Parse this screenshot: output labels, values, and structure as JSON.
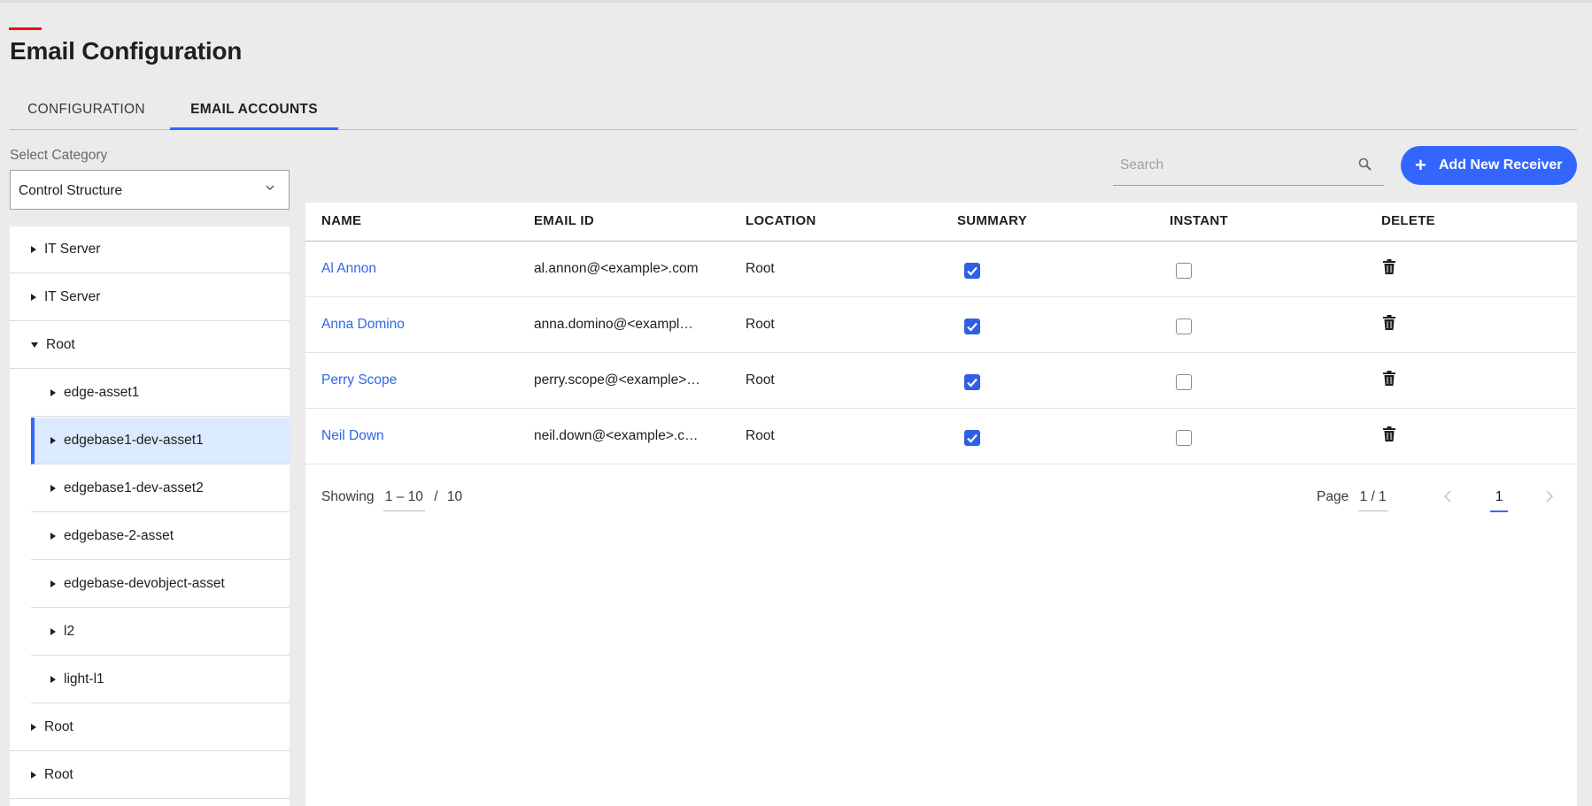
{
  "page": {
    "title": "Email Configuration"
  },
  "tabs": [
    {
      "label": "CONFIGURATION",
      "active": false
    },
    {
      "label": "EMAIL ACCOUNTS",
      "active": true
    }
  ],
  "category": {
    "label": "Select Category",
    "selected": "Control Structure"
  },
  "tree": [
    {
      "label": "IT Server",
      "level": 0,
      "expanded": false
    },
    {
      "label": "IT Server",
      "level": 0,
      "expanded": false
    },
    {
      "label": "Root",
      "level": 0,
      "expanded": true
    },
    {
      "label": "edge-asset1",
      "level": 1,
      "expanded": false
    },
    {
      "label": "edgebase1-dev-asset1",
      "level": 1,
      "expanded": false,
      "selected": true
    },
    {
      "label": "edgebase1-dev-asset2",
      "level": 1,
      "expanded": false
    },
    {
      "label": "edgebase-2-asset",
      "level": 1,
      "expanded": false
    },
    {
      "label": "edgebase-devobject-asset",
      "level": 1,
      "expanded": false
    },
    {
      "label": "l2",
      "level": 1,
      "expanded": false
    },
    {
      "label": "light-l1",
      "level": 1,
      "expanded": false
    },
    {
      "label": "Root",
      "level": 0,
      "expanded": false
    },
    {
      "label": "Root",
      "level": 0,
      "expanded": false
    }
  ],
  "search": {
    "placeholder": "Search",
    "icon": "search-icon"
  },
  "add_button": {
    "label": "Add New Receiver",
    "icon": "plus-icon"
  },
  "table": {
    "columns": [
      "NAME",
      "EMAIL ID",
      "LOCATION",
      "SUMMARY",
      "INSTANT",
      "DELETE"
    ],
    "rows": [
      {
        "name": "Al Annon",
        "email": "al.annon@<example>.com",
        "location": "Root",
        "summary": true,
        "instant": false
      },
      {
        "name": "Anna Domino",
        "email": "anna.domino@<exampl…",
        "location": "Root",
        "summary": true,
        "instant": false
      },
      {
        "name": "Perry Scope",
        "email": "perry.scope@<example>…",
        "location": "Root",
        "summary": true,
        "instant": false
      },
      {
        "name": "Neil Down",
        "email": "neil.down@<example>.c…",
        "location": "Root",
        "summary": true,
        "instant": false
      }
    ]
  },
  "pagination": {
    "showing_label": "Showing",
    "range": "1 – 10",
    "separator": "/",
    "total": "10",
    "page_label": "Page",
    "page_of": "1 / 1",
    "current": "1"
  },
  "colors": {
    "accent": "#3366ff",
    "brand_red": "#ff000f",
    "link": "#2e66e6",
    "selected_row": "#dbeafe"
  }
}
